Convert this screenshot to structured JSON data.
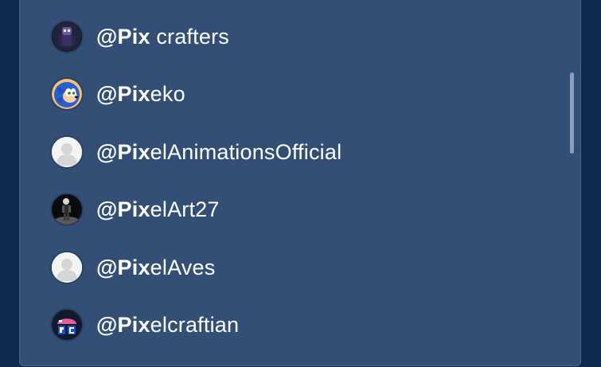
{
  "search": {
    "query_match": "@Pix"
  },
  "results": [
    {
      "match": "@Pix",
      "rest": " crafters",
      "avatar_icon": "dark-character-avatar-icon"
    },
    {
      "match": "@Pix",
      "rest": "eko",
      "avatar_icon": "blue-hedgehog-avatar-icon"
    },
    {
      "match": "@Pix",
      "rest": "elAnimationsOfficial",
      "avatar_icon": "default-user-avatar-icon"
    },
    {
      "match": "@Pix",
      "rest": "elArt27",
      "avatar_icon": "dark-figure-avatar-icon"
    },
    {
      "match": "@Pix",
      "rest": "elAves",
      "avatar_icon": "default-user-avatar-icon"
    },
    {
      "match": "@Pix",
      "rest": "elcraftian",
      "avatar_icon": "pixel-logo-avatar-icon"
    }
  ],
  "colors": {
    "background": "#0f2a50",
    "panel": "#344f75",
    "text": "#ffffff",
    "scrollbar": "#8aa0bd"
  }
}
